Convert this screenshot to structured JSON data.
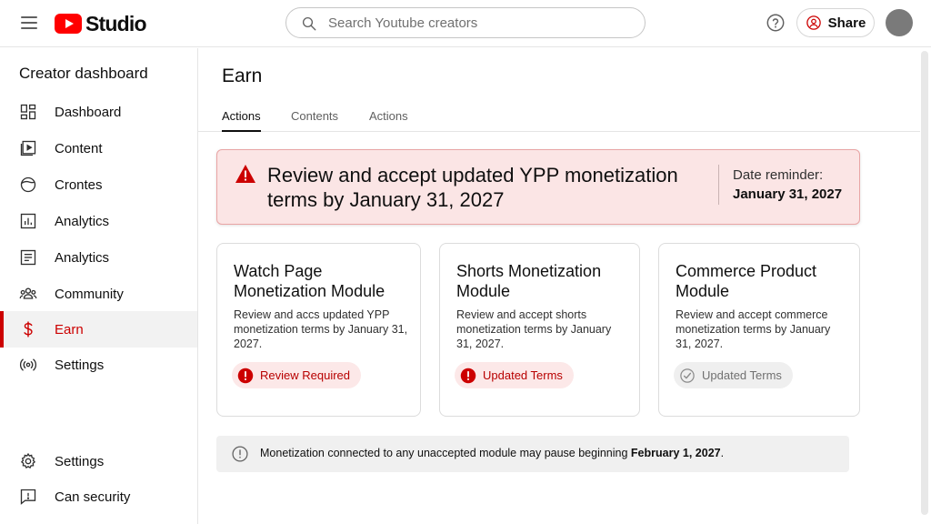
{
  "header": {
    "logo_text": "Studio",
    "search_placeholder": "Search Youtube creators",
    "share_label": "Share"
  },
  "sidebar": {
    "title": "Creator dashboard",
    "items": [
      {
        "label": "Dashboard",
        "icon": "dashboard-icon"
      },
      {
        "label": "Content",
        "icon": "content-icon"
      },
      {
        "label": "Crontes",
        "icon": "circle-icon"
      },
      {
        "label": "Analytics",
        "icon": "analytics-icon"
      },
      {
        "label": "Analytics",
        "icon": "list-icon"
      },
      {
        "label": "Community",
        "icon": "community-icon"
      },
      {
        "label": "Earn",
        "icon": "dollar-icon",
        "active": true
      },
      {
        "label": "Settings",
        "icon": "broadcast-icon"
      },
      {
        "label": "Settings",
        "icon": "gear-icon"
      },
      {
        "label": "Can security",
        "icon": "feedback-icon"
      }
    ]
  },
  "main": {
    "title": "Earn",
    "tabs": [
      {
        "label": "Actions",
        "active": true
      },
      {
        "label": "Contents"
      },
      {
        "label": "Actions"
      }
    ],
    "alert": {
      "title": "Review and accept updated YPP monetization terms by January 31, 2027",
      "date_label": "Date reminder:",
      "date_value": "January 31, 2027"
    },
    "cards": [
      {
        "title": "Watch Page Monetization Module",
        "description": "Review and accs updated YPP monetization terms by January 31, 2027.",
        "status": "Review Required",
        "status_kind": "error"
      },
      {
        "title": "Shorts Monetization Module",
        "description": "Review and accept shorts monetization terms by January 31, 2027.",
        "status": "Updated Terms",
        "status_kind": "error"
      },
      {
        "title": "Commerce Product Module",
        "description": "Review and accept commerce monetization terms by January 31, 2027.",
        "status": "Updated Terms",
        "status_kind": "done"
      }
    ],
    "notice": {
      "text": "Monetization connected to any unaccepted module may pause beginning ",
      "date": "February 1, 2027",
      "suffix": "."
    }
  },
  "colors": {
    "brand_red": "#ff0000",
    "active_red": "#cc0000",
    "alert_bg": "#fbe5e5",
    "chip_red_bg": "#fce8e8"
  }
}
